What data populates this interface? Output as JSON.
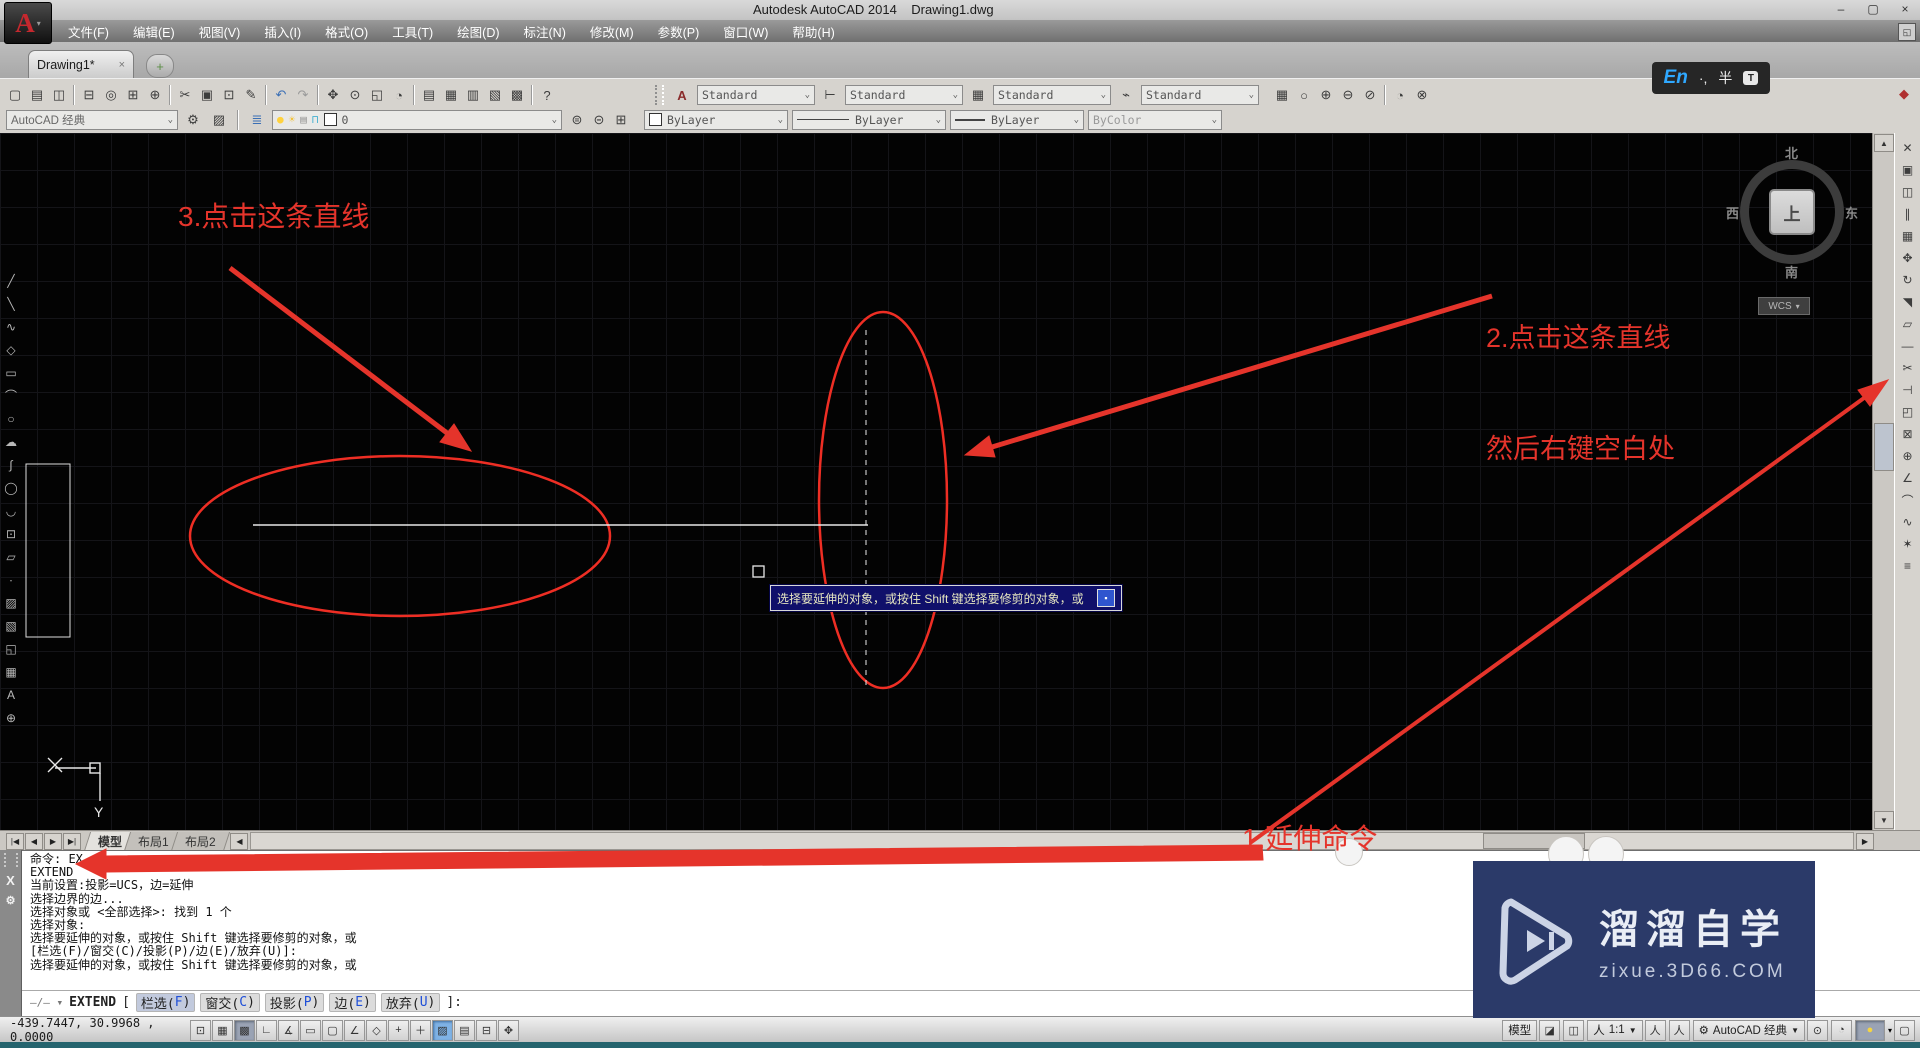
{
  "window": {
    "title": "Autodesk AutoCAD 2014    Drawing1.dwg",
    "buttons": [
      {
        "id": "minimize",
        "g": "–"
      },
      {
        "id": "maximize",
        "g": "▢"
      },
      {
        "id": "close",
        "g": "×"
      }
    ]
  },
  "logo": {
    "letter": "A",
    "chev": "▾"
  },
  "menu": {
    "items": [
      {
        "id": "file",
        "label": "文件(F)"
      },
      {
        "id": "edit",
        "label": "编辑(E)"
      },
      {
        "id": "view",
        "label": "视图(V)"
      },
      {
        "id": "insert",
        "label": "插入(I)"
      },
      {
        "id": "format",
        "label": "格式(O)"
      },
      {
        "id": "tools",
        "label": "工具(T)"
      },
      {
        "id": "draw",
        "label": "绘图(D)"
      },
      {
        "id": "dimension",
        "label": "标注(N)"
      },
      {
        "id": "modify",
        "label": "修改(M)"
      },
      {
        "id": "parametric",
        "label": "参数(P)"
      },
      {
        "id": "window",
        "label": "窗口(W)"
      },
      {
        "id": "help",
        "label": "帮助(H)"
      }
    ]
  },
  "doc_tab": {
    "label": "Drawing1*",
    "close": "×",
    "new_tab": "+"
  },
  "standard_toolbar": [
    {
      "n": "new",
      "g": "▢"
    },
    {
      "n": "open",
      "g": "▤"
    },
    {
      "n": "save",
      "g": "◫"
    },
    {
      "sep": true
    },
    {
      "n": "print",
      "g": "⊟"
    },
    {
      "n": "print-preview",
      "g": "◎"
    },
    {
      "n": "plot",
      "g": "⊞"
    },
    {
      "n": "publish",
      "g": "⊕"
    },
    {
      "sep": true
    },
    {
      "n": "cut",
      "g": "✂"
    },
    {
      "n": "copy",
      "g": "▣"
    },
    {
      "n": "paste",
      "g": "⊡"
    },
    {
      "n": "match-properties",
      "g": "✎"
    },
    {
      "sep": true
    },
    {
      "n": "undo",
      "g": "↶",
      "c": "#3b6fb5"
    },
    {
      "n": "redo",
      "g": "↷",
      "c": "#9a9a9a"
    },
    {
      "sep": true
    },
    {
      "n": "pan",
      "g": "✥"
    },
    {
      "n": "zoom-realtime",
      "g": "⊙"
    },
    {
      "n": "zoom-window",
      "g": "◱"
    },
    {
      "n": "zoom-previous",
      "g": "◔"
    },
    {
      "sep": true
    },
    {
      "n": "properties-palette",
      "g": "▤"
    },
    {
      "n": "designcenter",
      "g": "▦"
    },
    {
      "n": "tool-palettes",
      "g": "▥"
    },
    {
      "n": "sheet-set-manager",
      "g": "▧"
    },
    {
      "n": "quickcalc",
      "g": "▩"
    },
    {
      "sep": true
    },
    {
      "n": "help",
      "g": "?"
    }
  ],
  "styles_toolbar": {
    "text_style_icon": "A",
    "text_style": "Standard",
    "dim_style_icon": "⊢",
    "dim_style": "Standard",
    "table_style_icon": "▦",
    "table_style": "Standard",
    "leader_style_icon": "⌁",
    "leader_style": "Standard"
  },
  "viewport_toolbar": [
    {
      "n": "viewports",
      "g": "▦"
    },
    {
      "n": "named-views",
      "g": "○"
    },
    {
      "n": "view-add",
      "g": "⊕"
    },
    {
      "n": "view-remove",
      "g": "⊖"
    },
    {
      "n": "view-none",
      "g": "⊘"
    },
    {
      "sep": true
    },
    {
      "n": "view-prev",
      "g": "◔"
    },
    {
      "n": "view-del",
      "g": "⊗"
    }
  ],
  "ime": {
    "lang": "En",
    "punct": "·,",
    "shape": "半",
    "skin": "T"
  },
  "toolbar2": {
    "workspace": "AutoCAD 经典",
    "workspace_chev": "⌄",
    "gear_icon": "⚙",
    "lock_ws_icon": "▨",
    "layer_props_icon": "≣",
    "layer_icons": [
      {
        "n": "bulb",
        "g": "●",
        "c": "#ffd23e"
      },
      {
        "n": "sun",
        "g": "☀",
        "c": "#f2c23a"
      },
      {
        "n": "plot-col",
        "g": "▤",
        "c": "#9a9a9a"
      },
      {
        "n": "lock",
        "g": "⊓",
        "c": "#45b0d0"
      }
    ],
    "layer": "0",
    "layer_state_icons": [
      {
        "n": "layer-states",
        "g": "⊜"
      },
      {
        "n": "layer-prev",
        "g": "⊝"
      },
      {
        "n": "layer-match",
        "g": "⊞"
      }
    ],
    "color": "ByLayer",
    "linetype": "ByLayer",
    "lineweight": "ByLayer",
    "plotstyle": "ByColor"
  },
  "draw_toolbar": [
    {
      "n": "line",
      "g": "╱"
    },
    {
      "n": "construction-line",
      "g": "╲"
    },
    {
      "n": "polyline",
      "g": "∿"
    },
    {
      "n": "polygon",
      "g": "◇"
    },
    {
      "n": "rectangle",
      "g": "▭"
    },
    {
      "n": "arc",
      "g": "⌒"
    },
    {
      "n": "circle",
      "g": "○"
    },
    {
      "n": "revcloud",
      "g": "☁"
    },
    {
      "n": "spline",
      "g": "∫"
    },
    {
      "n": "ellipse",
      "g": "◯"
    },
    {
      "n": "ellipse-arc",
      "g": "◡"
    },
    {
      "n": "insert-block",
      "g": "⊡"
    },
    {
      "n": "make-block",
      "g": "▱"
    },
    {
      "n": "point",
      "g": "∙"
    },
    {
      "n": "hatch",
      "g": "▨"
    },
    {
      "n": "gradient",
      "g": "▧"
    },
    {
      "n": "region",
      "g": "◱"
    },
    {
      "n": "table",
      "g": "▦"
    },
    {
      "n": "mtext",
      "g": "A"
    },
    {
      "n": "add-selected",
      "g": "⊕"
    }
  ],
  "modify_toolbar": [
    {
      "n": "erase",
      "g": "✕"
    },
    {
      "n": "copy",
      "g": "▣"
    },
    {
      "n": "mirror",
      "g": "◫"
    },
    {
      "n": "offset",
      "g": "∥"
    },
    {
      "n": "array",
      "g": "▦"
    },
    {
      "n": "move",
      "g": "✥"
    },
    {
      "n": "rotate",
      "g": "↻"
    },
    {
      "n": "scale",
      "g": "◥"
    },
    {
      "n": "stretch",
      "g": "▱"
    },
    {
      "n": "lengthen",
      "g": "—"
    },
    {
      "n": "trim",
      "g": "✂"
    },
    {
      "n": "extend",
      "g": "⊣"
    },
    {
      "n": "break-at-point",
      "g": "◰"
    },
    {
      "n": "break",
      "g": "⊠"
    },
    {
      "n": "join",
      "g": "⊕"
    },
    {
      "n": "chamfer",
      "g": "∠"
    },
    {
      "n": "fillet",
      "g": "⌒"
    },
    {
      "n": "blend",
      "g": "∿"
    },
    {
      "n": "explode",
      "g": "✶"
    },
    {
      "n": "group",
      "g": "≡"
    }
  ],
  "viewcube": {
    "north": "北",
    "south": "南",
    "west": "西",
    "east": "东",
    "face": "上",
    "wcs": "WCS",
    "wcs_chev": "▾"
  },
  "annotations": {
    "step3": "3.点击这条直线",
    "step2_line1": "2.点击这条直线",
    "step2_line2": "然后右键空白处",
    "step1": "1.延伸命令",
    "tooltip": "选择要延伸的对象，或按住 Shift 键选择要修剪的对象，或",
    "tooltip_btn": "▪",
    "red": "#e5342b"
  },
  "layout_tabs": {
    "nav": [
      {
        "n": "first",
        "g": "|◀"
      },
      {
        "n": "prev",
        "g": "◀"
      },
      {
        "n": "next",
        "g": "▶"
      },
      {
        "n": "last",
        "g": "▶|"
      }
    ],
    "items": [
      {
        "id": "model",
        "label": "模型",
        "active": true
      },
      {
        "id": "layout1",
        "label": "布局1",
        "active": false
      },
      {
        "id": "layout2",
        "label": "布局2",
        "active": false
      }
    ],
    "hscroll_left": "◀",
    "hscroll_right": "▶"
  },
  "command": {
    "history": [
      "命令: EX",
      "EXTEND",
      "当前设置:投影=UCS，边=延伸",
      "选择边界的边...",
      "选择对象或 <全部选择>: 找到 1 个",
      "选择对象:",
      "选择要延伸的对象，或按住 Shift 键选择要修剪的对象，或",
      "[栏选(F)/窗交(C)/投影(P)/边(E)/放弃(U)]:",
      "选择要延伸的对象，或按住 Shift 键选择要修剪的对象，或"
    ],
    "prefix": "—/— ▾",
    "prompt_cmd": "EXTEND",
    "open": "[",
    "options": [
      {
        "pre": "栏选(",
        "key": "F",
        "post": ")"
      },
      {
        "pre": "窗交(",
        "key": "C",
        "post": ")"
      },
      {
        "pre": "投影(",
        "key": "P",
        "post": ")"
      },
      {
        "pre": "边(",
        "key": "E",
        "post": ")"
      },
      {
        "pre": "放弃(",
        "key": "U",
        "post": ")"
      }
    ],
    "close": "]:",
    "strip_x": "X",
    "strip_wrench": "⚙"
  },
  "status": {
    "coords": "-439.7447, 30.9968 , 0.0000",
    "toggles": [
      {
        "n": "infer-constraints",
        "g": "⊡"
      },
      {
        "n": "snap-mode",
        "g": "▦"
      },
      {
        "n": "grid-display",
        "g": "▩",
        "state": "pressed"
      },
      {
        "n": "ortho-mode",
        "g": "∟"
      },
      {
        "n": "polar-tracking",
        "g": "∡"
      },
      {
        "n": "isodraft",
        "g": "▭"
      },
      {
        "n": "object-snap",
        "g": "▢"
      },
      {
        "n": "object-snap-tracking",
        "g": "∠"
      },
      {
        "n": "dynamic-ucs",
        "g": "◇"
      },
      {
        "n": "dynamic-input",
        "g": "+"
      },
      {
        "n": "lineweight-show",
        "g": "＋"
      },
      {
        "n": "transparency",
        "g": "▨",
        "state": "blue"
      },
      {
        "n": "quick-properties",
        "g": "▤"
      },
      {
        "n": "selection-cycling",
        "g": "⊟"
      },
      {
        "n": "annotation-monitor",
        "g": "✥"
      }
    ],
    "model_label": "模型",
    "right_icons": [
      {
        "n": "layout-quick-view",
        "g": "◪"
      },
      {
        "n": "drawing-quick-view",
        "g": "◫"
      }
    ],
    "annot_person": "人",
    "scale": "1:1",
    "scale_chev": "▼",
    "annot_icons": [
      {
        "n": "annotation-visibility",
        "g": "人"
      },
      {
        "n": "annotation-autoscale",
        "g": "人"
      }
    ],
    "gear": "⚙",
    "workspace_label": "AutoCAD 经典",
    "ws_chev": "▼",
    "tail_icons": [
      {
        "n": "toolbar-lock",
        "g": "⊙"
      },
      {
        "n": "hardware-accel",
        "g": "◔"
      }
    ],
    "bulb": "●",
    "bulb_chev": "▾",
    "clean_screen": "▢"
  },
  "watermark": {
    "title": "溜溜自学",
    "url": "zixue.3D66.COM"
  },
  "colors": {
    "annotation_red": "#e5342b",
    "entity_red": "#ee2e24",
    "canvas_white": "#e8e8e8",
    "tooltip_bg": "#10106a",
    "watermark_bg": "#2b3a69"
  }
}
